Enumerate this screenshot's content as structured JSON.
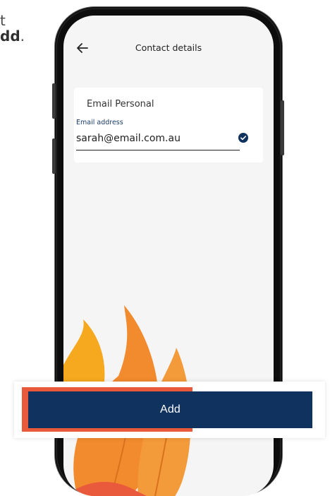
{
  "instruction": {
    "line1_fragment": "t",
    "line2_bold": "dd",
    "line2_tail": "."
  },
  "header": {
    "back_icon": "arrow-left-icon",
    "title": "Contact details"
  },
  "card": {
    "title": "Email Personal",
    "email_field": {
      "label": "Email address",
      "value": "sarah@email.com.au",
      "status_icon": "check-circle-icon"
    }
  },
  "actions": {
    "add_label": "Add"
  },
  "colors": {
    "primary": "#0f325e",
    "accent": "#e95a3c",
    "flame_orange": "#f28a2e",
    "flame_yellow": "#f6a81f",
    "screen_bg": "#f5f5f5"
  }
}
